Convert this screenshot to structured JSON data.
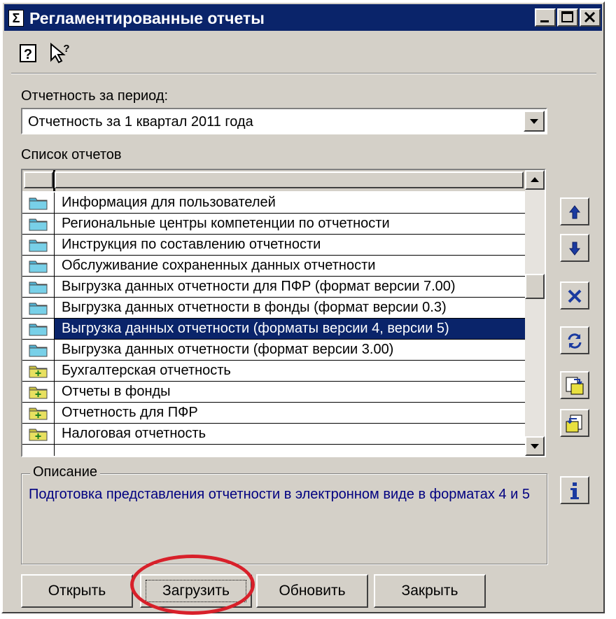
{
  "window": {
    "title": "Регламентированные отчеты",
    "app_icon": "sigma-icon",
    "controls": [
      "minimize-icon",
      "maximize-icon",
      "close-icon"
    ]
  },
  "toolbar": {
    "icons": [
      "help-icon",
      "context-help-icon"
    ]
  },
  "period": {
    "label": "Отчетность за период:",
    "value": "Отчетность за 1 квартал 2011 года"
  },
  "report_list": {
    "label": "Список отчетов",
    "items": [
      {
        "label": "Информация для пользователей",
        "icon": "folder-icon",
        "selected": false
      },
      {
        "label": "Региональные центры компетенции по отчетности",
        "icon": "folder-icon",
        "selected": false
      },
      {
        "label": "Инструкция по составлению отчетности",
        "icon": "folder-icon",
        "selected": false
      },
      {
        "label": "Обслуживание сохраненных данных отчетности",
        "icon": "folder-icon",
        "selected": false
      },
      {
        "label": "Выгрузка данных отчетности для ПФР (формат версии 7.00)",
        "icon": "folder-icon",
        "selected": false
      },
      {
        "label": "Выгрузка данных отчетности в фонды (формат версии 0.3)",
        "icon": "folder-icon",
        "selected": false
      },
      {
        "label": "Выгрузка данных отчетности (форматы версии 4, версии 5)",
        "icon": "folder-icon",
        "selected": true
      },
      {
        "label": "Выгрузка данных отчетности (формат версии 3.00)",
        "icon": "folder-icon",
        "selected": false
      },
      {
        "label": "Бухгалтерская отчетность",
        "icon": "folder-plus-icon",
        "selected": false
      },
      {
        "label": "Отчеты в фонды",
        "icon": "folder-plus-icon",
        "selected": false
      },
      {
        "label": "Отчетность для ПФР",
        "icon": "folder-plus-icon",
        "selected": false
      },
      {
        "label": "Налоговая отчетность",
        "icon": "folder-plus-icon",
        "selected": false
      }
    ]
  },
  "side_buttons": [
    "move-up-icon",
    "move-down-icon",
    "delete-icon",
    "refresh-icon",
    "import-icon",
    "export-icon"
  ],
  "description": {
    "label": "Описание",
    "text": "Подготовка представления отчетности в электронном виде в форматах 4 и 5",
    "info_icon": "info-icon"
  },
  "buttons": {
    "open": "Открыть",
    "load": "Загрузить",
    "update": "Обновить",
    "close": "Закрыть"
  },
  "colors": {
    "title_bar": "#0a246a",
    "selection": "#0a246a",
    "description_text": "#000080",
    "annotation": "#d8202a"
  }
}
